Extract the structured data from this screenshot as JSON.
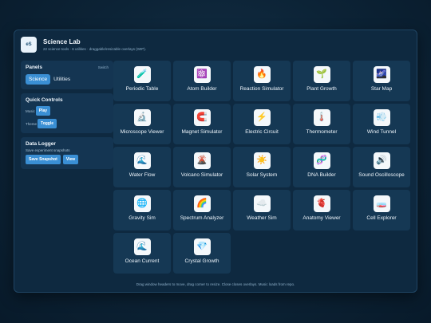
{
  "app": {
    "logo": "eS",
    "title": "Science Lab",
    "subtitle": "22 science tools · 6 utilities · draggable/resizable overlays (WIP)."
  },
  "panels": {
    "title": "Panels",
    "switch_label": "Switch",
    "tabs": [
      "Science",
      "Utilities"
    ],
    "active_tab": "Science"
  },
  "quick_controls": {
    "title": "Quick Controls",
    "music_label": "Music",
    "play_label": "Play",
    "theme_label": "Theme",
    "toggle_label": "Toggle"
  },
  "data_logger": {
    "title": "Data Logger",
    "description": "Save experiment snapshots",
    "save_label": "Save Snapshot",
    "view_label": "View"
  },
  "tools": [
    {
      "label": "Periodic Table",
      "icon": "🧪",
      "icon_name": "test-tube-icon"
    },
    {
      "label": "Atom Builder",
      "icon": "⚛️",
      "icon_name": "atom-icon"
    },
    {
      "label": "Reaction Simulator",
      "icon": "🔥",
      "icon_name": "fire-icon"
    },
    {
      "label": "Plant Growth",
      "icon": "🌱",
      "icon_name": "seedling-icon"
    },
    {
      "label": "Star Map",
      "icon": "🌌",
      "icon_name": "galaxy-icon"
    },
    {
      "label": "Microscope Viewer",
      "icon": "🔬",
      "icon_name": "microscope-icon"
    },
    {
      "label": "Magnet Simulator",
      "icon": "🧲",
      "icon_name": "magnet-icon"
    },
    {
      "label": "Electric Circuit",
      "icon": "⚡",
      "icon_name": "lightning-icon"
    },
    {
      "label": "Thermometer",
      "icon": "🌡️",
      "icon_name": "thermometer-icon"
    },
    {
      "label": "Wind Tunnel",
      "icon": "💨",
      "icon_name": "wind-icon"
    },
    {
      "label": "Water Flow",
      "icon": "🌊",
      "icon_name": "wave-icon"
    },
    {
      "label": "Volcano Simulator",
      "icon": "🌋",
      "icon_name": "volcano-icon"
    },
    {
      "label": "Solar System",
      "icon": "☀️",
      "icon_name": "sun-icon"
    },
    {
      "label": "DNA Builder",
      "icon": "🧬",
      "icon_name": "dna-icon"
    },
    {
      "label": "Sound Oscilloscope",
      "icon": "🔊",
      "icon_name": "speaker-icon"
    },
    {
      "label": "Gravity Sim",
      "icon": "🌐",
      "icon_name": "globe-icon"
    },
    {
      "label": "Spectrum Analyzer",
      "icon": "🌈",
      "icon_name": "rainbow-icon"
    },
    {
      "label": "Weather Sim",
      "icon": "☁️",
      "icon_name": "cloud-icon"
    },
    {
      "label": "Anatomy Viewer",
      "icon": "🫀",
      "icon_name": "heart-icon"
    },
    {
      "label": "Cell Explorer",
      "icon": "🧫",
      "icon_name": "petri-dish-icon"
    },
    {
      "label": "Ocean Current",
      "icon": "🌊",
      "icon_name": "wave-icon"
    },
    {
      "label": "Crystal Growth",
      "icon": "💎",
      "icon_name": "gem-icon"
    }
  ],
  "footer": "Drag window headers to move, drag corner to resize. Close closes overlays. Music loads from repo."
}
